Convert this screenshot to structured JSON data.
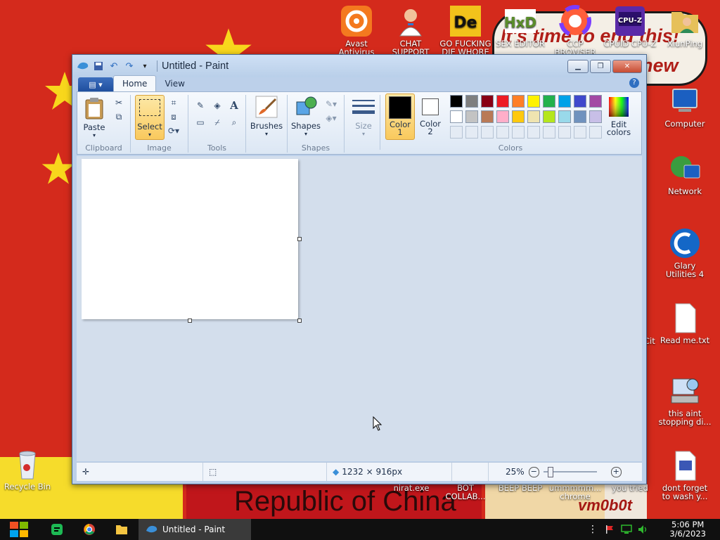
{
  "wallpaper": {
    "scribble_top": "It's time to end this!",
    "scribble_new": "new",
    "banner": "Republic of China",
    "tag": "vm0b0t",
    "partial_label": "Cit"
  },
  "desktop_icons_top": [
    {
      "name": "avast-icon",
      "label": "Avast Antivirus"
    },
    {
      "name": "chat-support-icon",
      "label": "CHAT SUPPORT"
    },
    {
      "name": "go-die-icon",
      "label": "GO FUCKING DIE WHORE"
    },
    {
      "name": "sex-editor-icon",
      "label": "SEX EDITOR"
    },
    {
      "name": "ccp-browser-icon",
      "label": "CCP BROWSER"
    },
    {
      "name": "cpuid-icon",
      "label": "CPUID CPU-Z"
    },
    {
      "name": "xiunping-icon",
      "label": "XiunPing"
    }
  ],
  "desktop_icons_right": [
    {
      "name": "computer-icon",
      "label": "Computer"
    },
    {
      "name": "network-icon",
      "label": "Network"
    },
    {
      "name": "glary-utilities-icon",
      "label": "Glary Utilities 4"
    },
    {
      "name": "readme-txt-icon",
      "label": "Read me.txt"
    },
    {
      "name": "this-aint-stopping-icon",
      "label": "this aint stopping di..."
    },
    {
      "name": "dont-forget-icon",
      "label": "dont forget to wash y..."
    }
  ],
  "desktop_icons_bottom": [
    {
      "name": "recycle-bin-icon",
      "label": "Recycle Bin"
    },
    {
      "name": "nirat-exe-icon",
      "label": "nirat.exe"
    },
    {
      "name": "bot-collab-icon",
      "label": "BOT COLLAB..."
    },
    {
      "name": "beep-beep-icon",
      "label": "BEEP BEEP"
    },
    {
      "name": "ummmm-chrome-icon",
      "label": "ummmmm... chrome"
    },
    {
      "name": "you-tried-icon",
      "label": "you tried"
    }
  ],
  "paint": {
    "title": "Untitled - Paint",
    "tabs": {
      "home": "Home",
      "view": "View"
    },
    "ribbon": {
      "paste": "Paste",
      "select": "Select",
      "brushes": "Brushes",
      "shapes": "Shapes",
      "size": "Size",
      "color1": "Color 1",
      "color2": "Color 2",
      "edit_colors": "Edit colors",
      "groups": {
        "clipboard": "Clipboard",
        "image": "Image",
        "tools": "Tools",
        "shapes": "Shapes",
        "colors": "Colors"
      }
    },
    "colors": {
      "color1": "#000000",
      "color2": "#ffffff",
      "row1": [
        "#000000",
        "#7f7f7f",
        "#880015",
        "#ed1c24",
        "#ff7f27",
        "#fff200",
        "#22b14c",
        "#00a2e8",
        "#3f48cc",
        "#a349a4"
      ],
      "row2": [
        "#ffffff",
        "#c3c3c3",
        "#b97a57",
        "#ffaec9",
        "#ffc90e",
        "#efe4b0",
        "#b5e61d",
        "#99d9ea",
        "#7092be",
        "#c8bfe7"
      ]
    },
    "status": {
      "image_size": "1232 × 916px",
      "zoom": "25%"
    }
  },
  "taskbar": {
    "active_app": "Untitled - Paint",
    "time": "5:06 PM",
    "date": "3/6/2023"
  }
}
